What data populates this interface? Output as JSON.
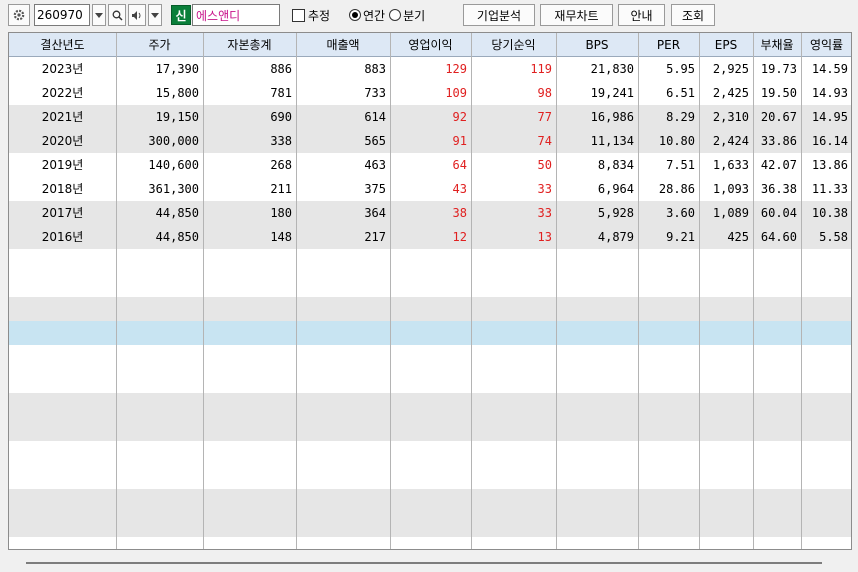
{
  "toolbar": {
    "gear_icon": "gear-icon",
    "stock_code": "260970",
    "new_badge": "신",
    "company_name": "에스앤디",
    "estimate_label": "추정",
    "annual_label": "연간",
    "quarterly_label": "분기",
    "selected_period": "연간",
    "btn_company_analysis": "기업분석",
    "btn_financial_chart": "재무차트",
    "btn_guide": "안내",
    "btn_query": "조회"
  },
  "table": {
    "headers": [
      "결산년도",
      "주가",
      "자본총계",
      "매출액",
      "영업이익",
      "당기순익",
      "BPS",
      "PER",
      "EPS",
      "부채율",
      "영익률"
    ],
    "rows": [
      [
        "2023년",
        "17,390",
        "886",
        "883",
        "129",
        "119",
        "21,830",
        "5.95",
        "2,925",
        "19.73",
        "14.59"
      ],
      [
        "2022년",
        "15,800",
        "781",
        "733",
        "109",
        "98",
        "19,241",
        "6.51",
        "2,425",
        "19.50",
        "14.93"
      ],
      [
        "2021년",
        "19,150",
        "690",
        "614",
        "92",
        "77",
        "16,986",
        "8.29",
        "2,310",
        "20.67",
        "14.95"
      ],
      [
        "2020년",
        "300,000",
        "338",
        "565",
        "91",
        "74",
        "11,134",
        "10.80",
        "2,424",
        "33.86",
        "16.14"
      ],
      [
        "2019년",
        "140,600",
        "268",
        "463",
        "64",
        "50",
        "8,834",
        "7.51",
        "1,633",
        "42.07",
        "13.86"
      ],
      [
        "2018년",
        "361,300",
        "211",
        "375",
        "43",
        "33",
        "6,964",
        "28.86",
        "1,093",
        "36.38",
        "11.33"
      ],
      [
        "2017년",
        "44,850",
        "180",
        "364",
        "38",
        "33",
        "5,928",
        "3.60",
        "1,089",
        "60.04",
        "10.38"
      ],
      [
        "2016년",
        "44,850",
        "148",
        "217",
        "12",
        "13",
        "4,879",
        "9.21",
        "425",
        "64.60",
        "5.58"
      ]
    ],
    "red_color": "#e02020",
    "selected_row_color": "#c8e4f2"
  }
}
